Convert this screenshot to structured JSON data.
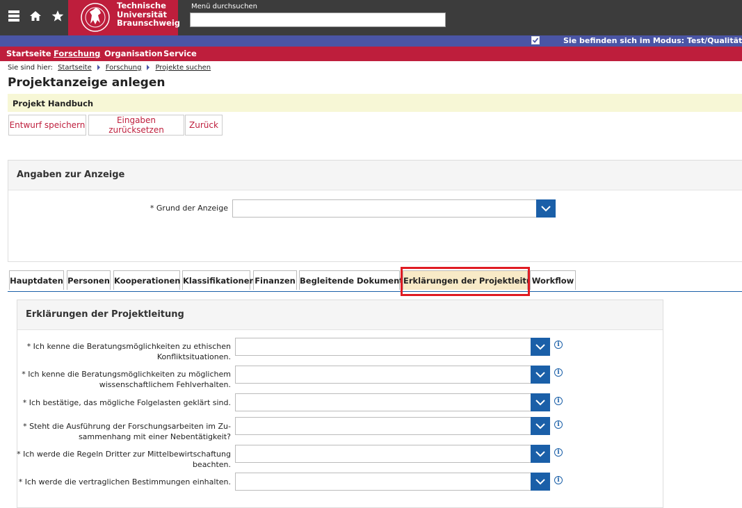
{
  "header": {
    "menu_icon": "hamburger-menu-icon",
    "home_icon": "home-icon",
    "star_icon": "star-icon",
    "university": {
      "line1": "Technische",
      "line2": "Universität",
      "line3": "Braunschweig"
    },
    "search": {
      "label": "Menü durchsuchen",
      "value": ""
    }
  },
  "mode_bar": {
    "text": "Sie befinden sich im Modus: Test/Qualitätssicherung",
    "checked": true
  },
  "nav": {
    "items": [
      "Startseite",
      "Forschung",
      "Organisation",
      "Service"
    ]
  },
  "breadcrumb": {
    "prefix": "Sie sind hier:",
    "items": [
      "Startseite",
      "Forschung",
      "Projekte suchen"
    ]
  },
  "page": {
    "title": "Projektanzeige anlegen",
    "handbook": "Projekt Handbuch",
    "buttons": {
      "save": "Entwurf speichern",
      "reset": "Eingaben zurücksetzen",
      "back": "Zurück"
    }
  },
  "announcement": {
    "heading": "Angaben zur Anzeige",
    "reason_label": "* Grund der Anzeige",
    "reason_value": ""
  },
  "tabs": [
    "Hauptdaten",
    "Personen",
    "Kooperationen",
    "Klassifikationen",
    "Finanzen",
    "Begleitende Dokumente",
    "Erklärungen der Projektleitung",
    "Workflow"
  ],
  "active_tab": "Erklärungen der Projektleitung",
  "declarations": {
    "heading": "Erklärungen der Projektleitung",
    "questions": [
      {
        "line1": "* Ich kenne die Beratungsmöglichkeiten zu ethischen",
        "line2": "Konfliktsituationen.",
        "value": ""
      },
      {
        "line1": "* Ich kenne die Beratungsmöglichkeiten zu möglichem",
        "line2": "wissenschaftlichem Fehlverhalten.",
        "value": ""
      },
      {
        "line1": "* Ich bestätige, das mögliche Folgelasten geklärt sind.",
        "line2": "",
        "value": ""
      },
      {
        "line1": "* Steht die Ausführung der Forschungsarbeiten im Zu-",
        "line2": "sammenhang mit einer Nebentätigkeit?",
        "value": ""
      },
      {
        "line1": "* Ich werde die Regeln Dritter zur Mittelbewirtschaftung",
        "line2": "beachten.",
        "value": ""
      },
      {
        "line1": "* Ich werde die vertraglichen Bestimmungen einhalten.",
        "line2": "",
        "value": ""
      }
    ]
  },
  "colors": {
    "brand_red": "#be1e3c",
    "mode_blue": "#4a55a5",
    "select_blue": "#1a5fa8",
    "highlight": "#e01b22"
  }
}
